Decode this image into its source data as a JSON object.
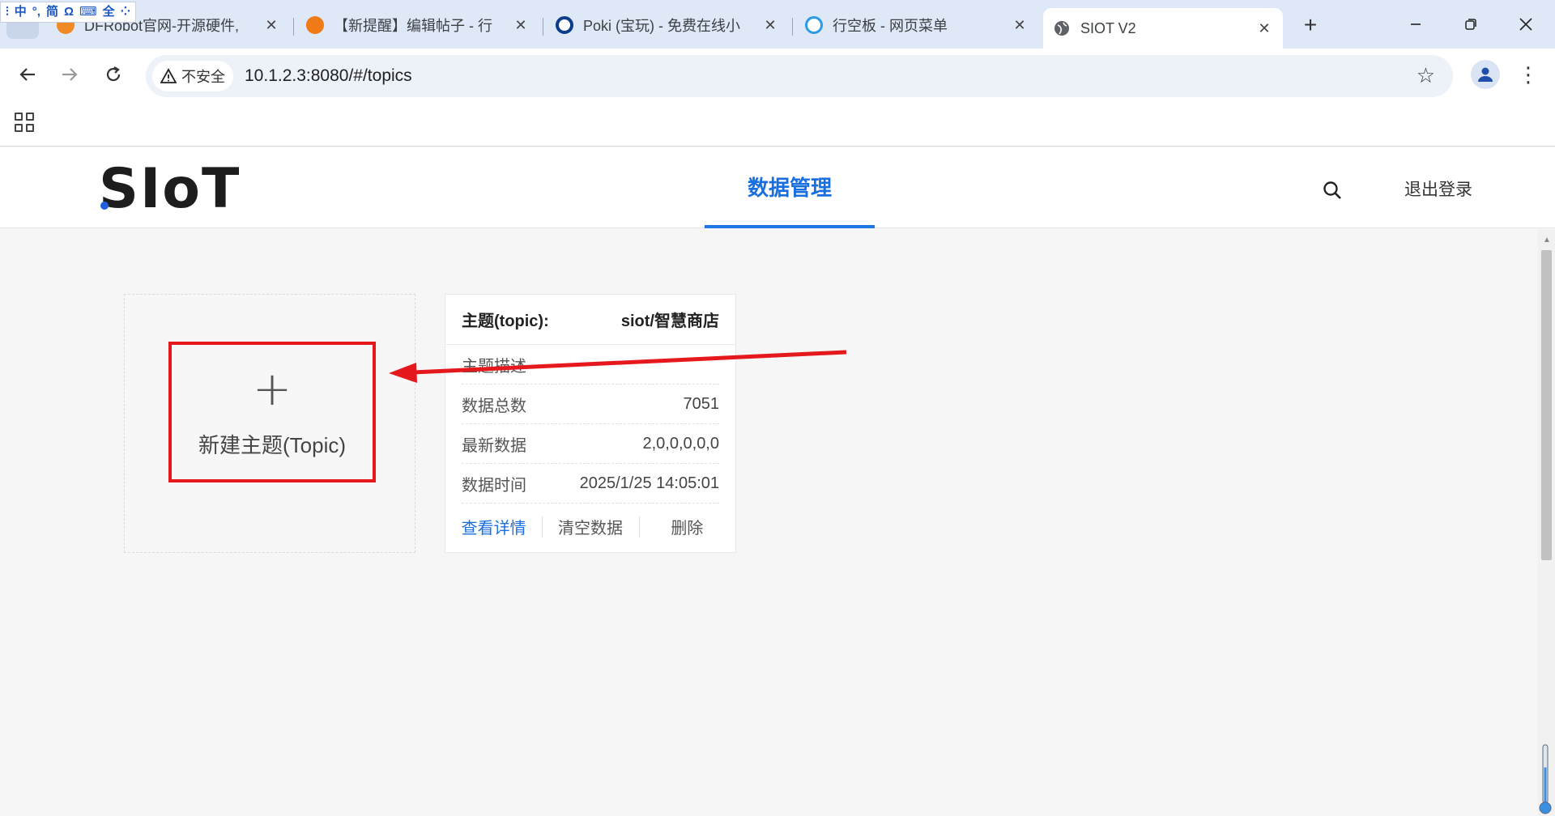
{
  "browser": {
    "ime_toolbar": [
      "中",
      "°,",
      "简",
      "Ω",
      "⌨",
      "全",
      "⁘"
    ],
    "tabs": [
      {
        "title": "DFRobot官网-开源硬件,",
        "active": false,
        "icon": "dfrobot-icon",
        "color": "#f08a24"
      },
      {
        "title": "【新提醒】编辑帖子 - 行",
        "active": false,
        "icon": "fox-icon",
        "color": "#f07a16"
      },
      {
        "title": "Poki (宝玩) - 免费在线小",
        "active": false,
        "icon": "poki-icon",
        "color": "#0b3d8c"
      },
      {
        "title": "行空板 - 网页菜单",
        "active": false,
        "icon": "unihiker-icon",
        "color": "#2b9be8"
      },
      {
        "title": "SIOT V2",
        "active": true,
        "icon": "globe-icon",
        "color": "#555555"
      }
    ],
    "close_glyph": "✕",
    "new_tab_glyph": "+",
    "address": {
      "security_label": "不安全",
      "url": "10.1.2.3:8080/#/topics"
    }
  },
  "site": {
    "logo": "SIoT",
    "nav_active": "数据管理",
    "logout": "退出登录",
    "accent": "#1a6fe0"
  },
  "new_topic": {
    "plus": "+",
    "label": "新建主题(Topic)",
    "highlight_color": "#e5191d"
  },
  "topic_card": {
    "header_label": "主题(topic):",
    "header_value": "siot/智慧商店",
    "rows": [
      {
        "label": "主题描述",
        "value": ""
      },
      {
        "label": "数据总数",
        "value": "7051"
      },
      {
        "label": "最新数据",
        "value": "2,0,0,0,0,0"
      },
      {
        "label": "数据时间",
        "value": "2025/1/25 14:05:01"
      }
    ],
    "actions": [
      "查看详情",
      "清空数据",
      "删除"
    ]
  }
}
